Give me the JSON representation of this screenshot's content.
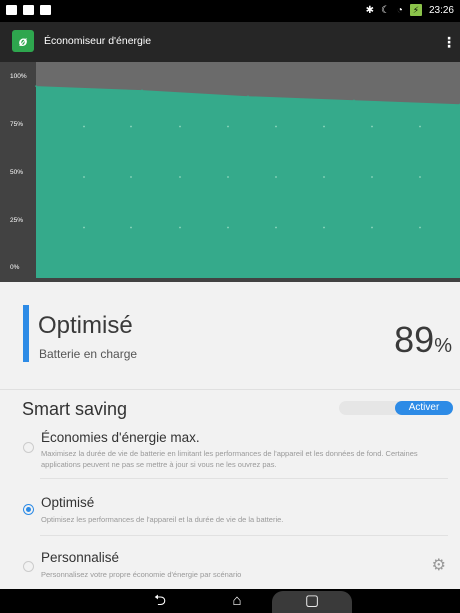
{
  "statusbar": {
    "time": "23:26",
    "icons": [
      "notification-icon",
      "message-icon",
      "image-icon",
      "bluetooth-icon",
      "moon-icon",
      "wifi-icon",
      "battery-charging-icon"
    ]
  },
  "appbar": {
    "title": "Économiseur d'énergie",
    "logo_glyph": "ø",
    "menu_glyph": "⋮"
  },
  "chart_data": {
    "type": "area",
    "title": "",
    "xlabel": "",
    "ylabel": "",
    "ylim": [
      0,
      100
    ],
    "yticks": [
      "100%",
      "75%",
      "50%",
      "25%",
      "0%"
    ],
    "grid": true,
    "values": [
      95,
      93,
      90,
      88,
      86
    ],
    "fill_color": "#34a98b",
    "colors": {
      "background": "#424242",
      "grid_dot": "#8fd8bd",
      "area": "#35aa8b",
      "top_band": "#6b6b6b"
    }
  },
  "status": {
    "mode": "Optimisé",
    "subtitle": "Batterie en charge",
    "percent_value": "89",
    "percent_unit": "%",
    "accent": "#2d8be6"
  },
  "smart_saving": {
    "title": "Smart saving",
    "toggle_label": "Activer"
  },
  "options": [
    {
      "title": "Économies d'énergie max.",
      "desc": "Maximisez la durée de vie de batterie en limitant les performances de l'appareil et les données de fond. Certaines applications peuvent ne pas se mettre à jour si vous ne les ouvrez pas.",
      "selected": false
    },
    {
      "title": "Optimisé",
      "desc": "Optimisez les performances de l'appareil et la durée de vie de la batterie.",
      "selected": true
    },
    {
      "title": "Personnalisé",
      "desc": "Personnalisez votre propre économie d'énergie par scénario",
      "selected": false
    }
  ],
  "navbar": {
    "back": "⮌",
    "home": "⌂",
    "recent": "▢"
  }
}
